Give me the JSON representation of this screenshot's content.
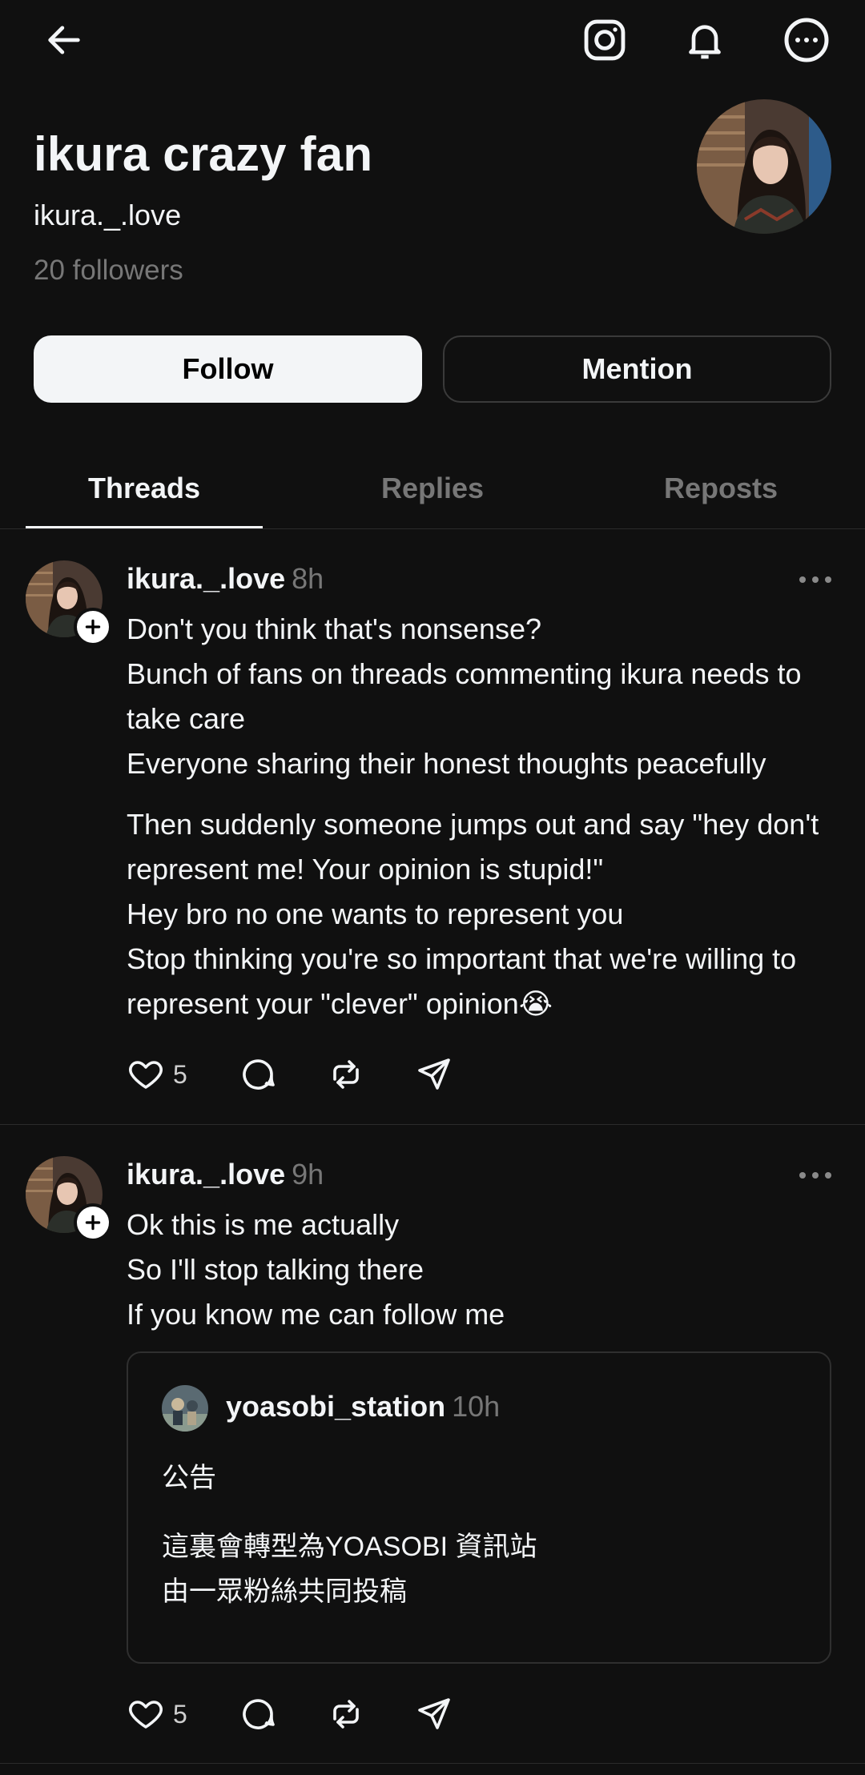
{
  "header": {
    "back_icon": "arrow-left-icon",
    "instagram_icon": "instagram-icon",
    "bell_icon": "bell-icon",
    "more_icon": "more-circle-icon"
  },
  "profile": {
    "name": "ikura crazy fan",
    "handle": "ikura._.love",
    "followers": "20 followers"
  },
  "buttons": {
    "follow": "Follow",
    "mention": "Mention"
  },
  "tabs": [
    {
      "label": "Threads"
    },
    {
      "label": "Replies"
    },
    {
      "label": "Reposts"
    }
  ],
  "posts": [
    {
      "user": "ikura._.love",
      "time": "8h",
      "lines": [
        "Don't you think that's nonsense?",
        "Bunch of fans on threads commenting ikura needs to take care",
        "Everyone sharing their honest thoughts peacefully",
        "Then suddenly someone jumps out and say \"hey don't represent me! Your opinion is stupid!\"",
        "Hey bro no one wants to represent you",
        "Stop thinking you're so important that we're willing to represent your \"clever\" opinion😭"
      ],
      "likes": "5"
    },
    {
      "user": "ikura._.love",
      "time": "9h",
      "lines": [
        "Ok this is me actually",
        "So I'll stop talking there",
        "If you know me can follow me"
      ],
      "quote": {
        "user": "yoasobi_station",
        "time": "10h",
        "lines": [
          "公告",
          "這裏會轉型為YOASOBI 資訊站",
          "由一眾粉絲共同投稿"
        ]
      },
      "likes": "5"
    }
  ],
  "colors": {
    "background": "#101010",
    "text": "#f3f5f7",
    "muted": "#777777",
    "border": "#2b2b2b"
  }
}
